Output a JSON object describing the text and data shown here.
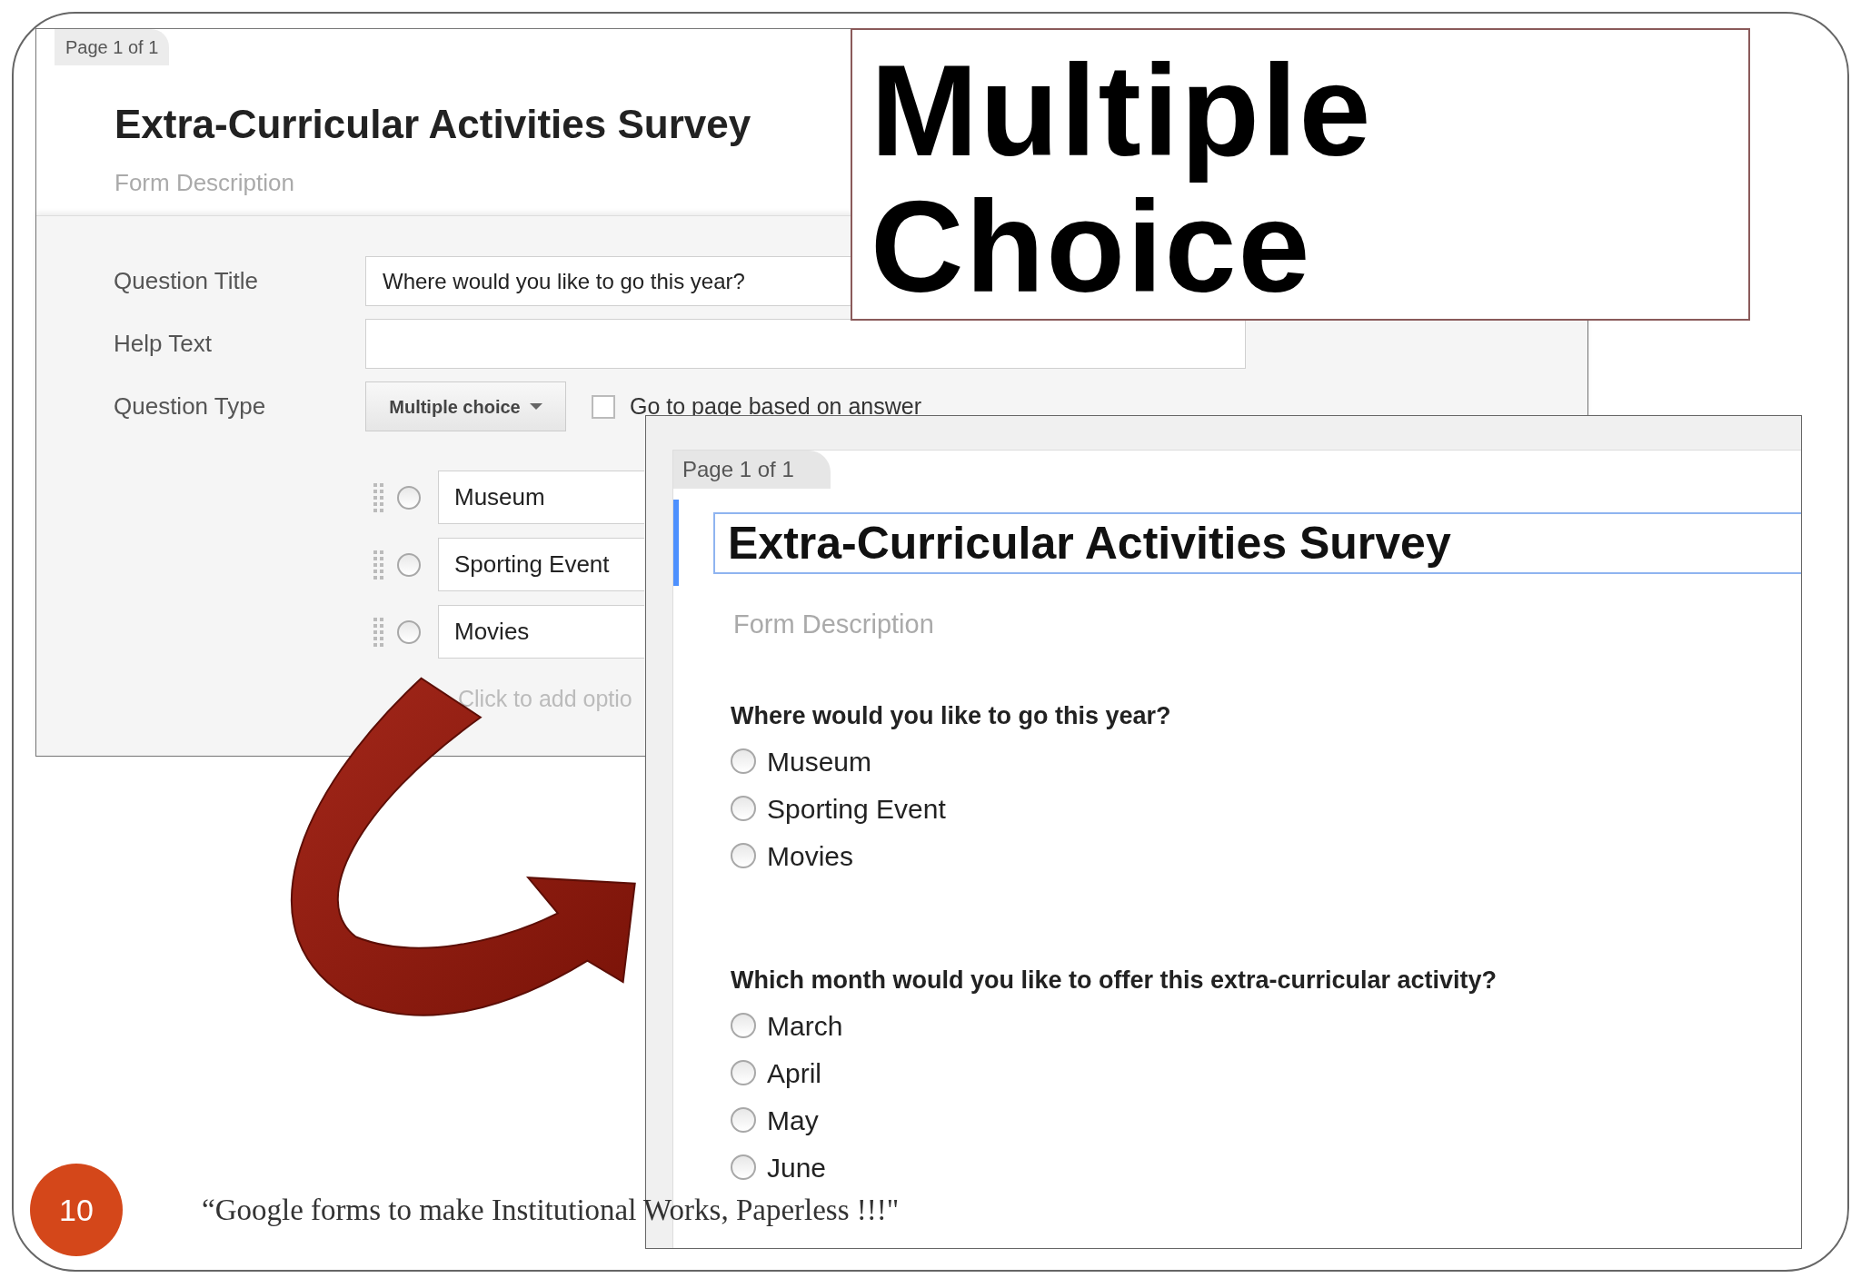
{
  "slide": {
    "title": "Multiple Choice",
    "page_number": "10",
    "footer": "“Google forms to make Institutional Works, Paperless !!!\""
  },
  "editor": {
    "page_tab": "Page 1 of 1",
    "form_title": "Extra-Curricular Activities Survey",
    "form_description_placeholder": "Form Description",
    "question_title": {
      "label": "Question Title",
      "value": "Where would you like to go this year?"
    },
    "help_text": {
      "label": "Help Text"
    },
    "question_type": {
      "label": "Question Type",
      "value": "Multiple choice"
    },
    "go_to_page": {
      "label": "Go to page based on answer",
      "checked": false
    },
    "options": [
      {
        "value": "Museum",
        "selected": false
      },
      {
        "value": "Sporting Event",
        "selected": false
      },
      {
        "value": "Movies",
        "selected": false
      }
    ],
    "add_option_placeholder": "Click to add optio"
  },
  "preview": {
    "page_tab": "Page 1 of 1",
    "form_title": "Extra-Curricular Activities Survey",
    "form_description_placeholder": "Form Description",
    "questions": [
      {
        "title": "Where would you like to go this year?",
        "options": [
          {
            "label": "Museum",
            "selected": false
          },
          {
            "label": "Sporting Event",
            "selected": false
          },
          {
            "label": "Movies",
            "selected": false
          }
        ]
      },
      {
        "title": "Which month would you like to offer this extra-curricular activity?",
        "options": [
          {
            "label": "March",
            "selected": false
          },
          {
            "label": "April",
            "selected": false
          },
          {
            "label": "May",
            "selected": false
          },
          {
            "label": "June",
            "selected": false
          }
        ]
      }
    ]
  }
}
